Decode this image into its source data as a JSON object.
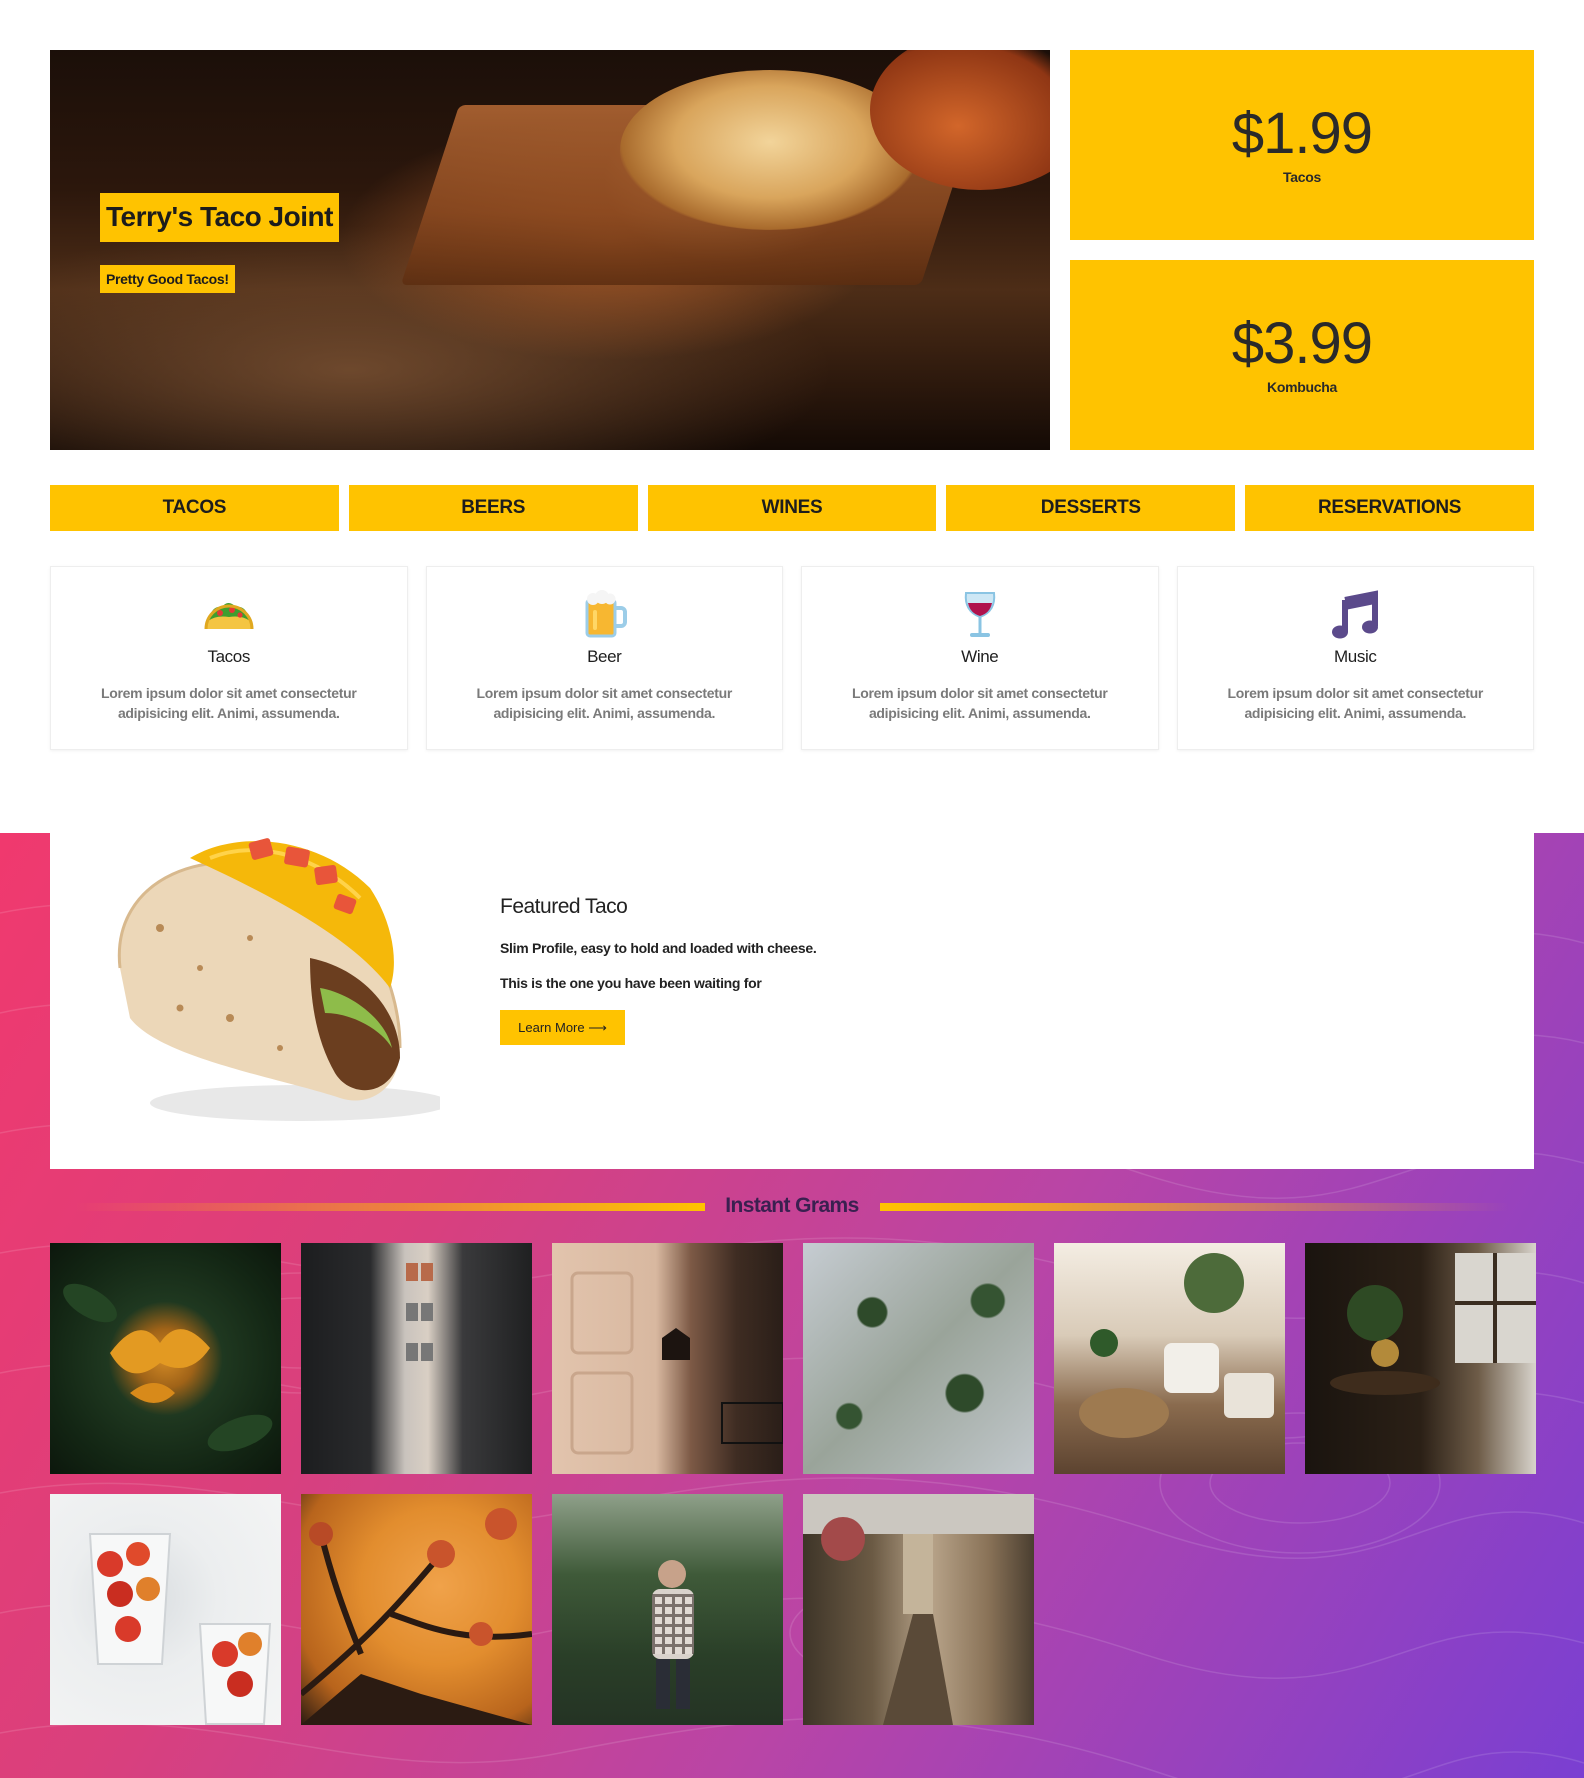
{
  "hero": {
    "title": "Terry's Taco Joint",
    "subtitle": "Pretty Good Tacos!"
  },
  "prices": [
    {
      "amount": "$1.99",
      "label": "Tacos"
    },
    {
      "amount": "$3.99",
      "label": "Kombucha"
    }
  ],
  "nav": [
    "TACOS",
    "BEERS",
    "WINES",
    "DESSERTS",
    "RESERVATIONS"
  ],
  "features": [
    {
      "icon": "taco-icon",
      "title": "Tacos",
      "desc": "Lorem ipsum dolor sit amet consectetur adipisicing elit. Animi, assumenda."
    },
    {
      "icon": "beer-icon",
      "title": "Beer",
      "desc": "Lorem ipsum dolor sit amet consectetur adipisicing elit. Animi, assumenda."
    },
    {
      "icon": "wine-icon",
      "title": "Wine",
      "desc": "Lorem ipsum dolor sit amet consectetur adipisicing elit. Animi, assumenda."
    },
    {
      "icon": "music-icon",
      "title": "Music",
      "desc": "Lorem ipsum dolor sit amet consectetur adipisicing elit. Animi, assumenda."
    }
  ],
  "featured": {
    "title": "Featured Taco",
    "line1": "Slim Profile, easy to hold and loaded with cheese.",
    "line2": "This is the one you have been waiting for",
    "button": "Learn More ⟶"
  },
  "grams": {
    "title": "Instant Grams"
  },
  "colors": {
    "accent": "#ffc300",
    "gradient_start": "#f0396e",
    "gradient_end": "#7a3fd2"
  }
}
